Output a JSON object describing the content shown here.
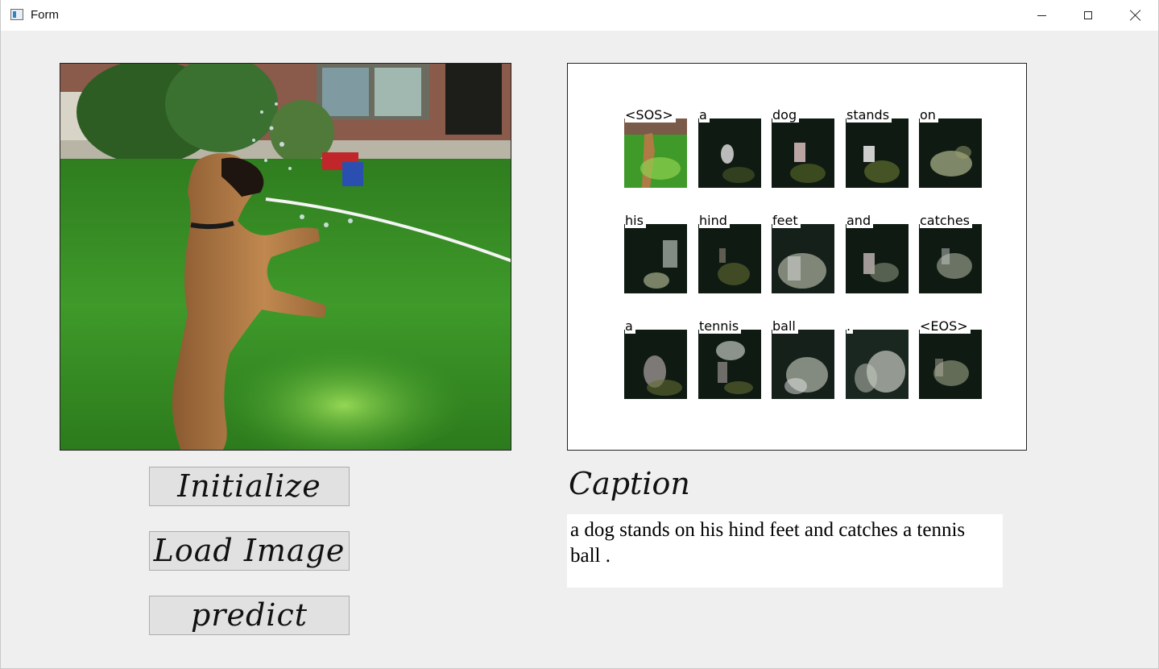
{
  "window": {
    "title": "Form",
    "controls": [
      "minimize",
      "maximize",
      "close"
    ]
  },
  "buttons": {
    "initialize": "Initialize",
    "load_image": "Load Image",
    "predict": "predict"
  },
  "attention": {
    "words": [
      "<SOS>",
      "a",
      "dog",
      "stands",
      "on",
      "his",
      "hind",
      "feet",
      "and",
      "catches",
      "a",
      "tennis",
      "ball",
      ".",
      "<EOS>"
    ]
  },
  "caption": {
    "heading": "Caption",
    "text": "a dog stands on his hind feet and catches a tennis ball ."
  },
  "colors": {
    "grass": "#3f9a2a",
    "dog": "#b07a45",
    "house_brick": "#8a5a4a",
    "attention_dark": "#0f1a12"
  }
}
